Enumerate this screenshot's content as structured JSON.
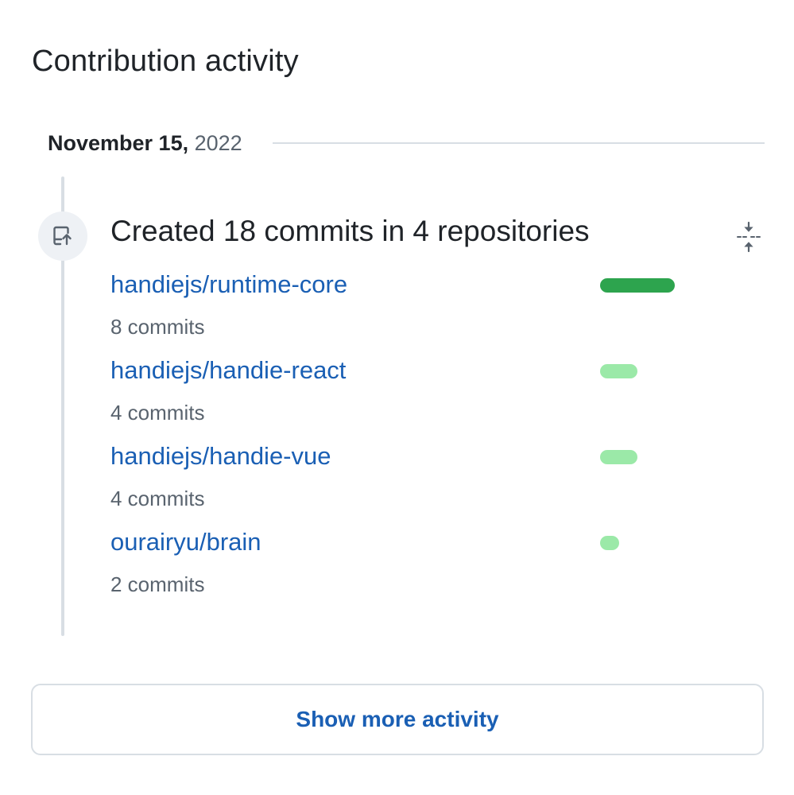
{
  "section": {
    "title": "Contribution activity"
  },
  "date_group": {
    "month_day": "November 15,",
    "year": "2022"
  },
  "event": {
    "title": "Created 18 commits in 4 repositories",
    "icon": "repo-push-icon",
    "collapse_icon": "fold-icon"
  },
  "repositories": [
    {
      "name": "handiejs/runtime-core",
      "commits": "8 commits",
      "share": 1.0,
      "color": "#2da44e"
    },
    {
      "name": "handiejs/handie-react",
      "commits": "4 commits",
      "share": 0.5,
      "color": "#9be9a8"
    },
    {
      "name": "handiejs/handie-vue",
      "commits": "4 commits",
      "share": 0.5,
      "color": "#9be9a8"
    },
    {
      "name": "ourairyu/brain",
      "commits": "2 commits",
      "share": 0.25,
      "color": "#9be9a8"
    }
  ],
  "footer": {
    "show_more_label": "Show more activity"
  }
}
